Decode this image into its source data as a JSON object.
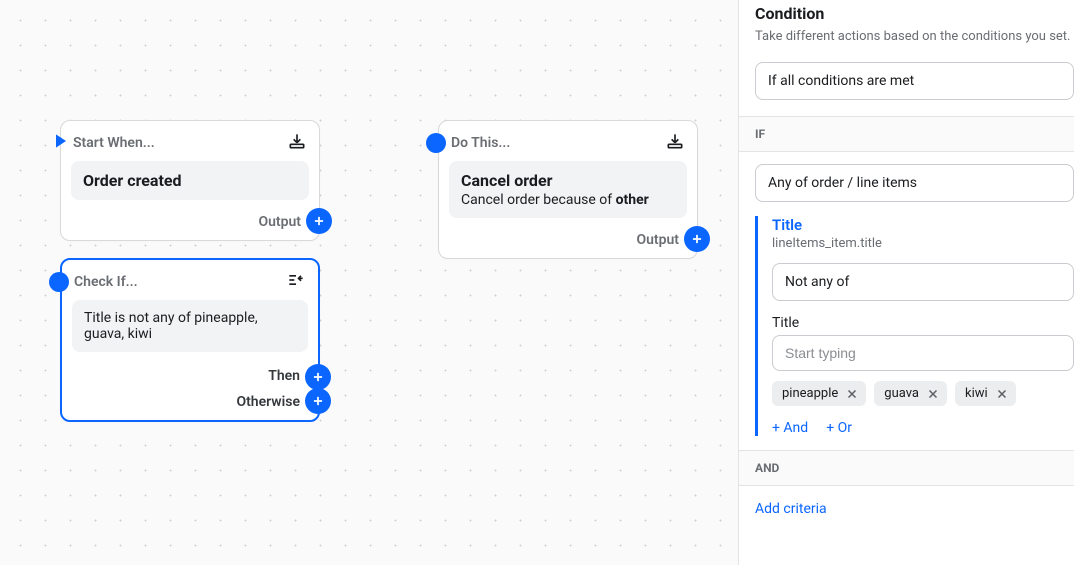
{
  "nodes": {
    "start": {
      "header": "Start When...",
      "title": "Order created",
      "output_label": "Output"
    },
    "condition": {
      "header": "Check If...",
      "summary": "Title is not any of pineapple, guava, kiwi",
      "then_label": "Then",
      "otherwise_label": "Otherwise"
    },
    "action": {
      "header": "Do This...",
      "title": "Cancel order",
      "subtitle_prefix": "Cancel order because of ",
      "subtitle_reason": "other",
      "output_label": "Output"
    }
  },
  "panel": {
    "title": "Condition",
    "description": "Take different actions based on the conditions you set.",
    "mode_select": "If all conditions are met",
    "if_header": "IF",
    "scope_select": "Any of order / line items",
    "criteria": {
      "title": "Title",
      "path": "lineItems_item.title",
      "operator_select": "Not any of",
      "value_label": "Title",
      "value_placeholder": "Start typing",
      "chips": [
        "pineapple",
        "guava",
        "kiwi"
      ],
      "add_and": "+ And",
      "add_or": "+ Or"
    },
    "and_header": "AND",
    "add_criteria": "Add criteria"
  }
}
